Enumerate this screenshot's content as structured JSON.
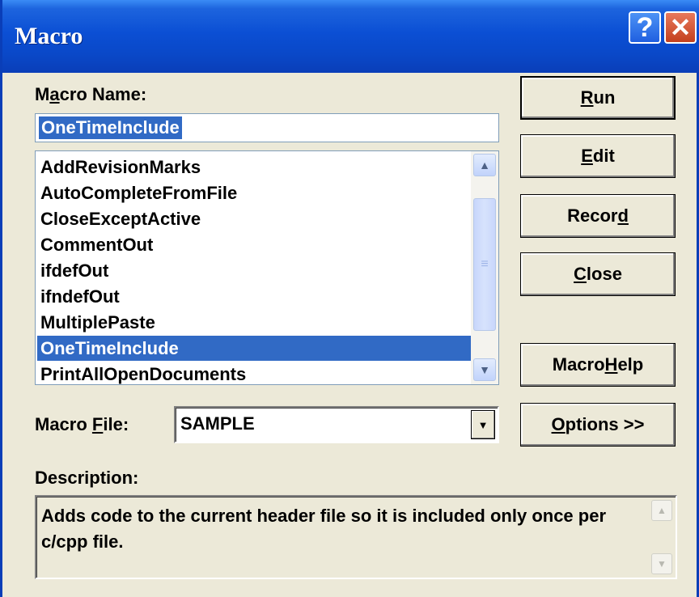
{
  "window": {
    "title": "Macro",
    "help_icon": "?",
    "close_icon": "✕"
  },
  "macro_name": {
    "label_pre": "M",
    "label_u": "a",
    "label_post": "cro Name:",
    "value": "OneTimeInclude"
  },
  "macro_list": {
    "items": [
      "AddRevisionMarks",
      "AutoCompleteFromFile",
      "CloseExceptActive",
      "CommentOut",
      "ifdefOut",
      "ifndefOut",
      "MultiplePaste",
      "OneTimeInclude",
      "PrintAllOpenDocuments"
    ],
    "selected_index": 7,
    "up_arrow": "▲",
    "down_arrow": "▼",
    "thumb_grip": "≡"
  },
  "buttons": {
    "run": {
      "u": "R",
      "post": "un"
    },
    "edit": {
      "u": "E",
      "post": "dit"
    },
    "record": {
      "pre": "Recor",
      "u": "d"
    },
    "close": {
      "u": "C",
      "post": "lose"
    },
    "macro_help": {
      "pre": "Macro ",
      "u": "H",
      "post": "elp"
    },
    "options": {
      "u": "O",
      "post": "ptions >>"
    }
  },
  "macro_file": {
    "label_pre": "Macro ",
    "label_u": "F",
    "label_post": "ile:",
    "value": "SAMPLE",
    "arrow": "▼"
  },
  "description": {
    "label": "Description:",
    "text": "Adds code to the current header file so it is included only once per c/cpp file.",
    "up_arrow": "▲",
    "down_arrow": "▼"
  }
}
